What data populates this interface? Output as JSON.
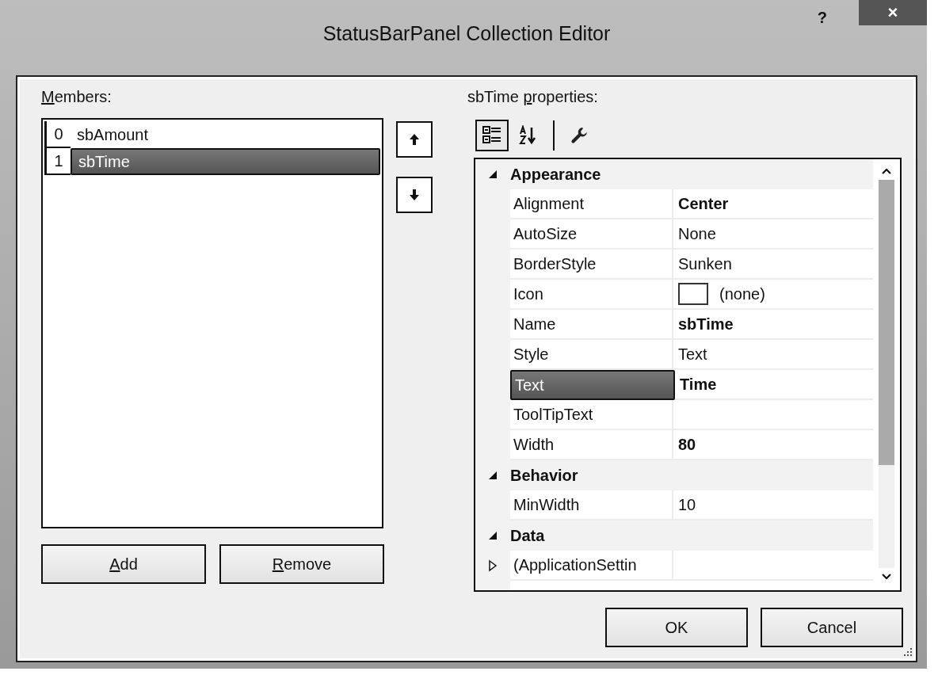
{
  "window": {
    "title": "StatusBarPanel Collection Editor",
    "help": "?",
    "close": "×"
  },
  "members": {
    "label": "Members:",
    "items": [
      {
        "index": "0",
        "name": "sbAmount",
        "selected": false
      },
      {
        "index": "1",
        "name": "sbTime",
        "selected": true
      }
    ],
    "buttons": [
      {
        "label": "Add"
      },
      {
        "label": "Remove"
      }
    ]
  },
  "move_buttons": [
    {
      "kind": "up"
    },
    {
      "kind": "down"
    }
  ],
  "properties": {
    "label": "sbTime properties:",
    "toolbar": [
      {
        "kind": "categorized",
        "selected": true
      },
      {
        "kind": "alphabetical",
        "selected": false
      },
      {
        "kind": "property-pages",
        "selected": false
      }
    ],
    "categories": [
      {
        "name": "Appearance",
        "rows": [
          {
            "kind": "text",
            "name": "Alignment",
            "value": "Center",
            "modified": true,
            "selected": false
          },
          {
            "kind": "text",
            "name": "AutoSize",
            "value": "None",
            "modified": false,
            "selected": false
          },
          {
            "kind": "text",
            "name": "BorderStyle",
            "value": "Sunken",
            "modified": false,
            "selected": false
          },
          {
            "kind": "icon",
            "name": "Icon",
            "value": "(none)",
            "modified": false,
            "selected": false
          },
          {
            "kind": "text",
            "name": "Name",
            "value": "sbTime",
            "modified": true,
            "selected": false
          },
          {
            "kind": "text",
            "name": "Style",
            "value": "Text",
            "modified": false,
            "selected": false
          },
          {
            "kind": "text",
            "name": "Text",
            "value": "Time",
            "modified": true,
            "selected": true
          },
          {
            "kind": "text",
            "name": "ToolTipText",
            "selected": false
          },
          {
            "kind": "text",
            "name": "Width",
            "value": "80",
            "modified": true,
            "selected": false
          }
        ]
      },
      {
        "name": "Behavior",
        "rows": [
          {
            "kind": "text",
            "name": "MinWidth",
            "value": "10",
            "modified": false,
            "selected": false
          }
        ]
      },
      {
        "name": "Data",
        "rows": [
          {
            "kind": "expandable",
            "name": "(ApplicationSettin",
            "selected": false
          }
        ]
      }
    ]
  },
  "buttons": [
    {
      "label": "OK"
    },
    {
      "label": "Cancel"
    }
  ]
}
